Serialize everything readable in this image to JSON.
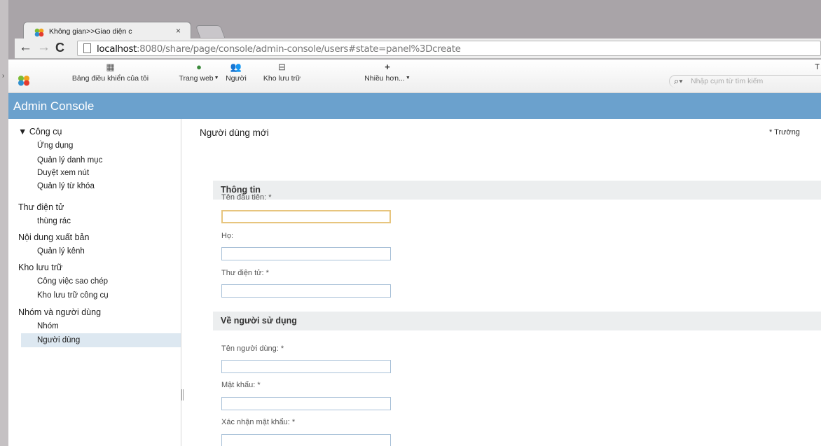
{
  "browser": {
    "tab": {
      "title": "Không gian>>Giao diện c",
      "close_glyph": "×"
    },
    "nav": {
      "back": "←",
      "forward": "→",
      "reload": "C"
    },
    "url": {
      "host": "localhost",
      "rest": ":8080/share/page/console/admin-console/users#state=panel%3Dcreate"
    }
  },
  "header": {
    "items": [
      {
        "label": "Bảng điều khiển của tôi",
        "icon": "dashboard-icon"
      },
      {
        "label": "Trang web",
        "icon": "globe-icon"
      },
      {
        "label": "Người",
        "icon": "people-icon"
      },
      {
        "label": "Kho lưu trữ",
        "icon": "repository-icon"
      },
      {
        "label": "Nhiều hơn...",
        "icon": "plus-icon"
      }
    ],
    "user_letter": "T",
    "search_placeholder": "Nhập cụm từ tìm kiếm"
  },
  "console": {
    "title": "Admin Console"
  },
  "sidebar": {
    "groups": [
      {
        "label": "▼ Công cụ",
        "items": [
          "Ứng dụng",
          "Quản lý danh mục",
          "Duyệt xem nút",
          "Quản lý từ khóa"
        ]
      },
      {
        "label": "Thư điện tử",
        "items": [
          "thùng rác"
        ]
      },
      {
        "label": "Nội dung xuất bản",
        "items": [
          "Quản lý kênh"
        ]
      },
      {
        "label": "Kho lưu trữ",
        "items": [
          "Công việc sao chép",
          "Kho lưu trữ công cụ"
        ]
      },
      {
        "label": "Nhóm và người dùng",
        "items": [
          "Nhóm",
          "Người dùng"
        ]
      }
    ],
    "selected": "Người dùng"
  },
  "form": {
    "title": "Người dùng mới",
    "required_note": "* Trường",
    "sections": [
      {
        "title": "Thông tin"
      },
      {
        "title": "Về người sử dụng"
      }
    ],
    "fields": {
      "first_name": {
        "label": "Tên đầu tiên: *",
        "value": ""
      },
      "last_name": {
        "label": "Họ:",
        "value": ""
      },
      "email": {
        "label": "Thư điện tử: *",
        "value": ""
      },
      "username": {
        "label": "Tên người dùng: *",
        "value": ""
      },
      "password": {
        "label": "Mật khẩu: *",
        "value": ""
      },
      "confirm_password": {
        "label": "Xác nhận mật khẩu: *",
        "value": ""
      }
    }
  },
  "colors": {
    "console_bar": "#6ba1cd",
    "section_header": "#eceeef",
    "focus_border": "#e7c57e",
    "input_border": "#a9c1d8",
    "selected_nav": "#dde8f1"
  }
}
